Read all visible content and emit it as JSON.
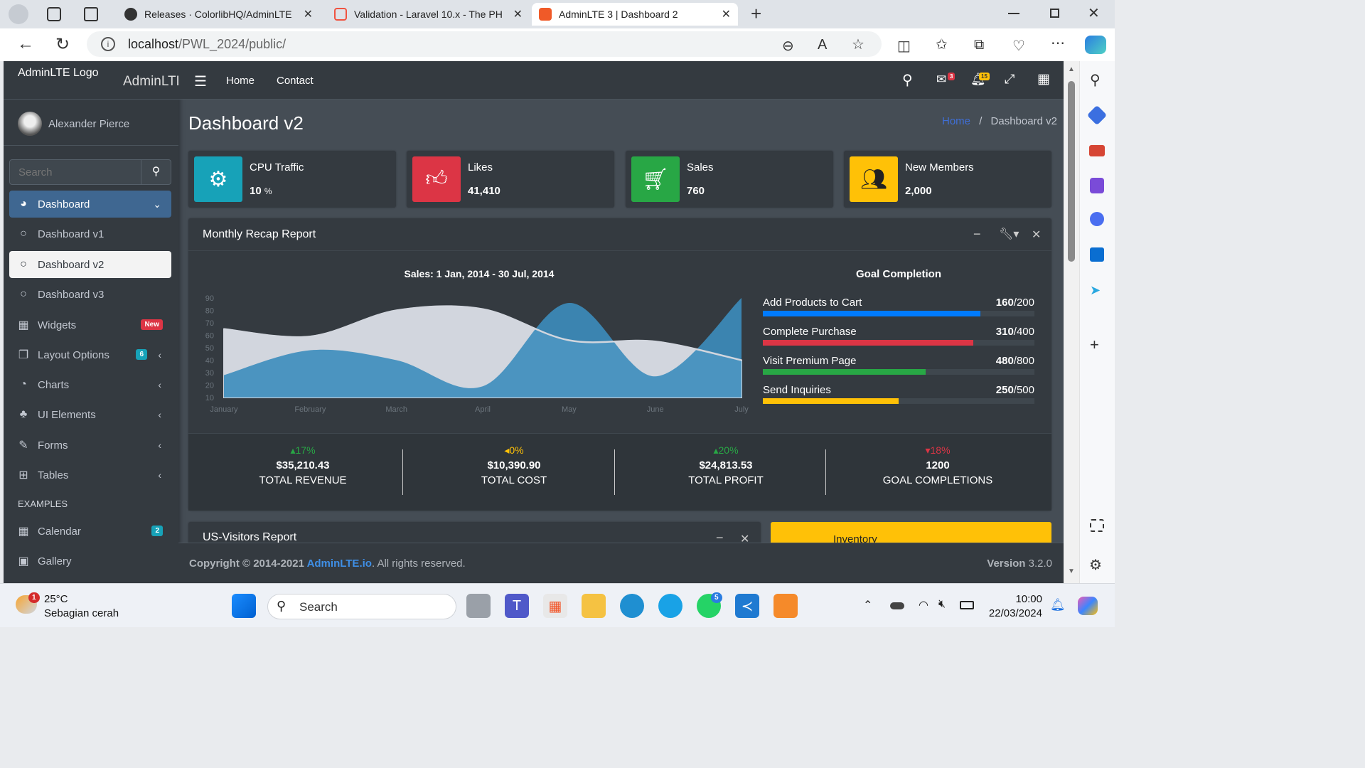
{
  "browser": {
    "tabs": [
      {
        "title": "Releases · ColorlibHQ/AdminLTE"
      },
      {
        "title": "Validation - Laravel 10.x - The PH"
      },
      {
        "title": "AdminLTE 3 | Dashboard 2"
      }
    ],
    "url_host": "localhost",
    "url_path": "/PWL_2024/public/"
  },
  "brand": {
    "logo_alt": "AdminLTE Logo",
    "text": "AdminLTE"
  },
  "user": {
    "name": "Alexander Pierce"
  },
  "sidebar": {
    "search_placeholder": "Search",
    "items": [
      {
        "label": "Dashboard"
      },
      {
        "label": "Dashboard v1"
      },
      {
        "label": "Dashboard v2"
      },
      {
        "label": "Dashboard v3"
      },
      {
        "label": "Widgets",
        "badge": "New"
      },
      {
        "label": "Layout Options",
        "badge": "6"
      },
      {
        "label": "Charts"
      },
      {
        "label": "UI Elements"
      },
      {
        "label": "Forms"
      },
      {
        "label": "Tables"
      }
    ],
    "section_header": "EXAMPLES",
    "examples": [
      {
        "label": "Calendar",
        "badge": "2"
      },
      {
        "label": "Gallery"
      }
    ]
  },
  "topnav": {
    "home": "Home",
    "contact": "Contact",
    "messages_count": "3",
    "notifications_count": "15"
  },
  "page": {
    "title": "Dashboard v2",
    "breadcrumb_home": "Home",
    "breadcrumb_current": "Dashboard v2"
  },
  "info_boxes": [
    {
      "label": "CPU Traffic",
      "value": "10",
      "unit": "%",
      "color": "#17a2b8",
      "icon": "gear-icon"
    },
    {
      "label": "Likes",
      "value": "41,410",
      "color": "#dc3545",
      "icon": "thumbs-up-icon"
    },
    {
      "label": "Sales",
      "value": "760",
      "color": "#28a745",
      "icon": "cart-icon"
    },
    {
      "label": "New Members",
      "value": "2,000",
      "color": "#ffc107",
      "icon": "users-icon"
    }
  ],
  "report": {
    "title": "Monthly Recap Report",
    "chart_title": "Sales: 1 Jan, 2014 - 30 Jul, 2014",
    "goal_title": "Goal Completion",
    "goals": [
      {
        "label": "Add Products to Cart",
        "done": "160",
        "total": "/200",
        "fraction": 0.8,
        "color": "#007bff"
      },
      {
        "label": "Complete Purchase",
        "done": "310",
        "total": "/400",
        "fraction": 0.775,
        "color": "#dc3545"
      },
      {
        "label": "Visit Premium Page",
        "done": "480",
        "total": "/800",
        "fraction": 0.6,
        "color": "#28a745"
      },
      {
        "label": "Send Inquiries",
        "done": "250",
        "total": "/500",
        "fraction": 0.5,
        "color": "#ffc107"
      }
    ],
    "stats": [
      {
        "pct": "17%",
        "dir": "up",
        "amount": "$35,210.43",
        "label": "TOTAL REVENUE",
        "color": "#28a745"
      },
      {
        "pct": "0%",
        "dir": "left",
        "amount": "$10,390.90",
        "label": "TOTAL COST",
        "color": "#ffc107"
      },
      {
        "pct": "20%",
        "dir": "up",
        "amount": "$24,813.53",
        "label": "TOTAL PROFIT",
        "color": "#28a745"
      },
      {
        "pct": "18%",
        "dir": "down",
        "amount": "1200",
        "label": "GOAL COMPLETIONS",
        "color": "#dc3545"
      }
    ]
  },
  "chart_data": {
    "type": "area",
    "title": "Sales: 1 Jan, 2014 - 30 Jul, 2014",
    "categories": [
      "January",
      "February",
      "March",
      "April",
      "May",
      "June",
      "July"
    ],
    "ylim": [
      10,
      90
    ],
    "y_ticks": [
      10,
      20,
      30,
      40,
      50,
      60,
      70,
      80,
      90
    ],
    "series": [
      {
        "values": [
          65,
          59,
          80,
          81,
          56,
          55,
          40
        ],
        "color": "#d2d6de"
      },
      {
        "values": [
          28,
          48,
          40,
          19,
          86,
          27,
          90
        ],
        "color": "#3c8dbc"
      }
    ]
  },
  "bottom_cards": {
    "visitors": "US-Visitors Report",
    "inventory": "Inventory"
  },
  "footer": {
    "copyright": "Copyright © 2014-2021 ",
    "link": "AdminLTE.io",
    "rights": ". All rights reserved.",
    "version_label": "Version",
    "version": " 3.2.0"
  },
  "taskbar": {
    "temp": "25°C",
    "weather": "Sebagian cerah",
    "search": "Search",
    "time": "10:00",
    "date": "22/03/2024",
    "weather_badge": "1",
    "whatsapp_badge": "5"
  }
}
